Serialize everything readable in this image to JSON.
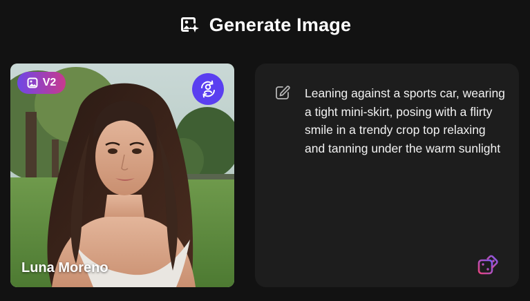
{
  "header": {
    "title": "Generate Image",
    "icon": "image-sparkle-icon"
  },
  "character_card": {
    "version_badge": "V2",
    "badge_icon": "image-icon",
    "name": "Luna Moreno",
    "swap_icon": "swap-character-icon"
  },
  "prompt": {
    "text": "Leaning against a sports car, wearing a tight mini-skirt, posing with a flirty smile in a trendy crop top relaxing and tanning under the warm sunlight",
    "edit_icon": "edit-pencil-icon",
    "randomize_icon": "dice-icon"
  },
  "colors": {
    "background": "#121212",
    "panel": "#1d1d1d",
    "accent_purple": "#5a3ff0",
    "badge_gradient_start": "#6f47e6",
    "badge_gradient_end": "#c8398d",
    "dice_gradient_start": "#7b5cf5",
    "dice_gradient_end": "#e8437e"
  }
}
